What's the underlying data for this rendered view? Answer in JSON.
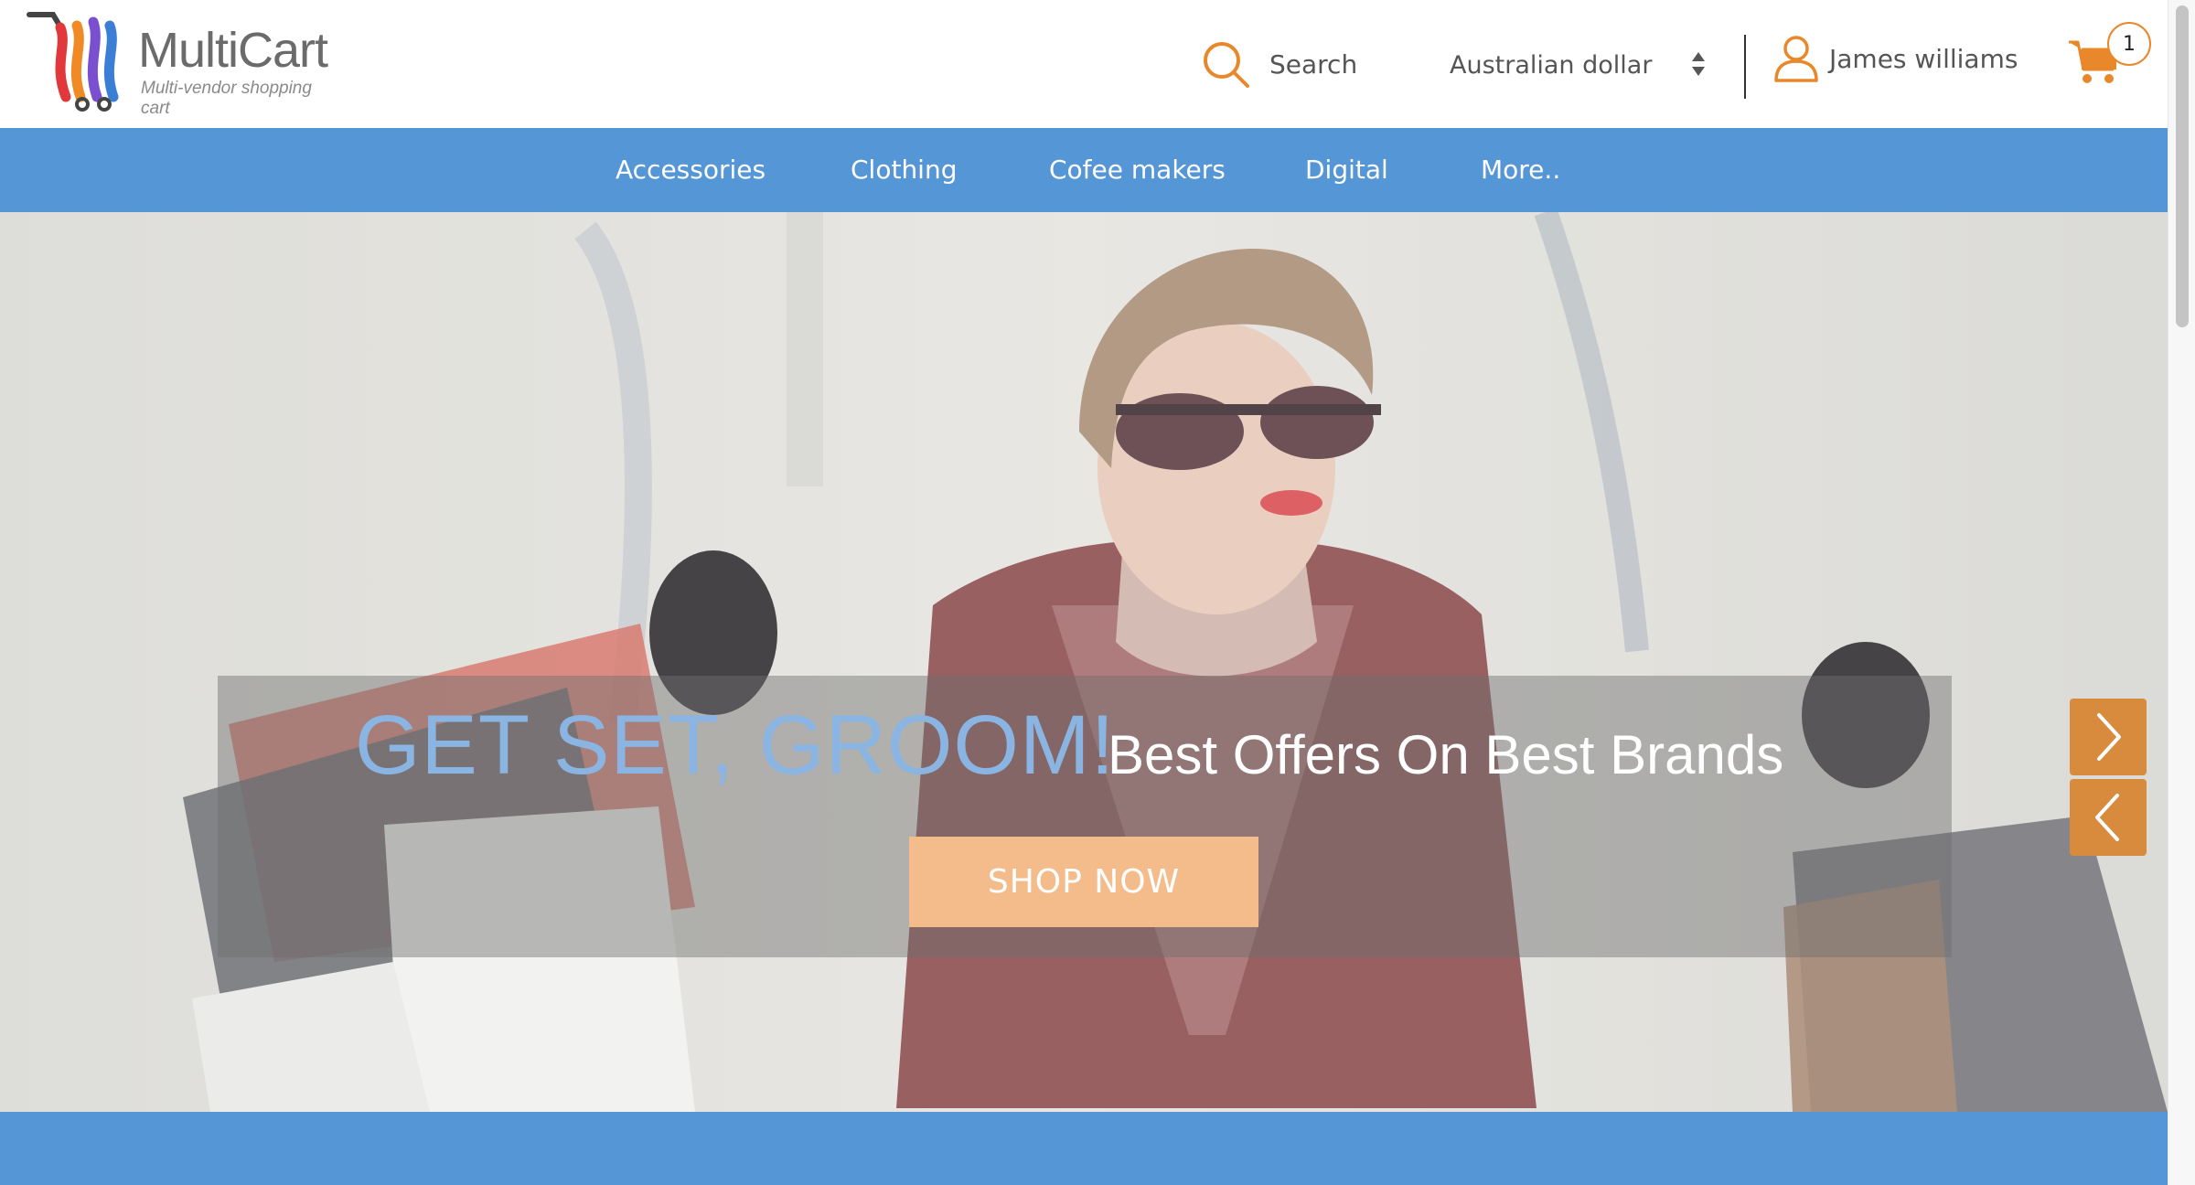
{
  "brand": {
    "name": "MultiCart",
    "tagline": "Multi-vendor shopping cart",
    "colors": {
      "primary_blue": "#5596d6",
      "accent_orange": "#e8882b",
      "logo_red": "#e0383b",
      "logo_orange": "#f08a24",
      "logo_purple": "#7a4fd0",
      "logo_blue": "#3a7fd5"
    }
  },
  "header": {
    "search_label": "Search",
    "search_icon": "search-icon",
    "currency": "Australian dollar",
    "user_name": "James williams",
    "user_icon": "user-icon",
    "cart_icon": "cart-icon",
    "cart_count": "1"
  },
  "nav": {
    "items": [
      {
        "label": "Accessories"
      },
      {
        "label": "Clothing"
      },
      {
        "label": "Cofee makers"
      },
      {
        "label": "Digital"
      },
      {
        "label": "More.."
      }
    ]
  },
  "hero": {
    "title": "GET SET, GROOM!",
    "subtitle": "Best Offers On Best Brands",
    "cta_label": "SHOP NOW",
    "next_icon": "chevron-right-icon",
    "prev_icon": "chevron-left-icon"
  }
}
